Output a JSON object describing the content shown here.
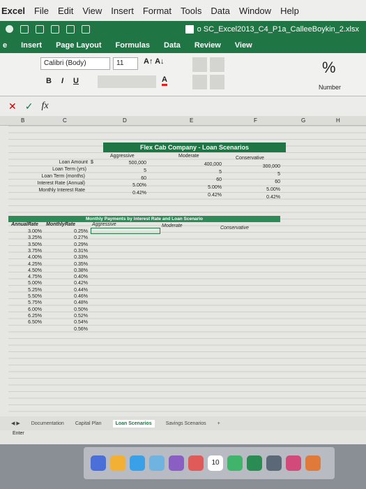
{
  "menubar": {
    "app": "Excel",
    "items": [
      "File",
      "Edit",
      "View",
      "Insert",
      "Format",
      "Tools",
      "Data",
      "Window",
      "Help"
    ]
  },
  "titlebar": {
    "doc_title": "o SC_Excel2013_C4_P1a_CalleeBoykin_2.xlsx"
  },
  "ribbon_tabs": [
    "e",
    "Insert",
    "Page Layout",
    "Formulas",
    "Data",
    "Review",
    "View"
  ],
  "ribbon": {
    "font_name": "Calibri (Body)",
    "font_size": "11",
    "grow_shrink": "A↑ A↓",
    "bold": "B",
    "italic": "I",
    "underline": "U",
    "font_color": "A",
    "percent": "%",
    "number_format": "Number"
  },
  "formula_bar": {
    "cancel": "✕",
    "enter": "✓",
    "fx": "fx"
  },
  "columns": [
    "B",
    "C",
    "D",
    "E",
    "F",
    "G",
    "H"
  ],
  "scenario": {
    "title": "Flex Cab Company - Loan Scenarios",
    "headers": [
      "Aggressive",
      "Moderate",
      "Conservative"
    ],
    "rows": [
      {
        "label": "Loan Amount",
        "cur": "$",
        "v": [
          "500,000",
          "400,000",
          "300,000"
        ]
      },
      {
        "label": "Loan Term (yrs)",
        "cur": "",
        "v": [
          "5",
          "5",
          "5"
        ]
      },
      {
        "label": "Loan Term (months)",
        "cur": "",
        "v": [
          "60",
          "60",
          "60"
        ]
      },
      {
        "label": "Interest Rate (Annual)",
        "cur": "",
        "v": [
          "5.00%",
          "5.00%",
          "5.00%"
        ]
      },
      {
        "label": "Monthly Interest Rate",
        "cur": "",
        "v": [
          "0.42%",
          "0.42%",
          "0.42%"
        ]
      }
    ]
  },
  "payments": {
    "title": "Monthly Payments by Interest Rate and Loan Scenario",
    "col_annual": "AnnualRate",
    "col_monthly": "MonthlyRate",
    "headers": [
      "Aggressive",
      "Moderate",
      "Conservative"
    ],
    "annual": [
      "3.00%",
      "3.25%",
      "3.50%",
      "3.75%",
      "4.00%",
      "4.25%",
      "4.50%",
      "4.75%",
      "5.00%",
      "5.25%",
      "5.50%",
      "5.75%",
      "6.00%",
      "6.25%",
      "6.50%"
    ],
    "monthly": [
      "0.25%",
      "0.27%",
      "0.29%",
      "0.31%",
      "0.33%",
      "0.35%",
      "0.38%",
      "0.40%",
      "0.42%",
      "0.44%",
      "0.46%",
      "0.48%",
      "0.50%",
      "0.52%",
      "0.54%",
      "0.56%"
    ]
  },
  "sheet_tabs": [
    "Documentation",
    "Capital Plan",
    "Loan Scenarios",
    "Savings Scenarios",
    "+"
  ],
  "active_tab": "Loan Scenarios",
  "status": "Enter",
  "dock": {
    "calendar_day": "10"
  },
  "colors": {
    "excel_green": "#1f7544"
  }
}
